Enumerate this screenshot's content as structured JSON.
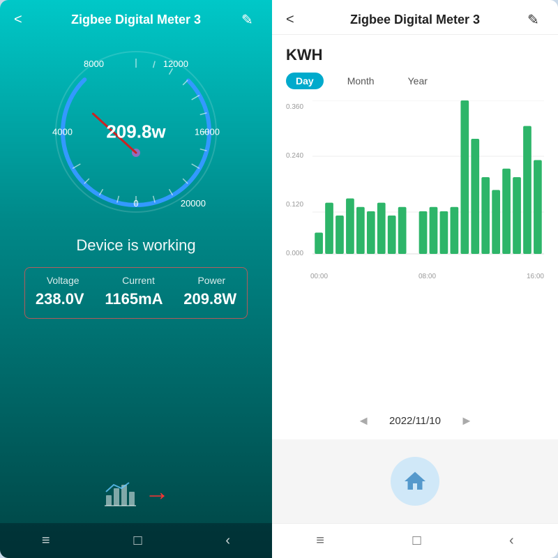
{
  "leftPanel": {
    "header": {
      "title": "Zigbee Digital Meter 3",
      "backLabel": "<",
      "editLabel": "✎"
    },
    "gauge": {
      "value": "209.8w",
      "scaleLabels": [
        "0",
        "4000",
        "8000",
        "12000",
        "16000",
        "20000"
      ]
    },
    "status": "Device is working",
    "stats": {
      "headers": [
        "Voltage",
        "Current",
        "Power"
      ],
      "values": [
        "238.0V",
        "1165mA",
        "209.8W"
      ]
    },
    "navBar": {
      "menu": "≡",
      "home": "□",
      "back": "‹"
    }
  },
  "rightPanel": {
    "header": {
      "title": "Zigbee Digital Meter 3",
      "backLabel": "<",
      "editLabel": "✎"
    },
    "kwhLabel": "KWH",
    "tabs": [
      "Day",
      "Month",
      "Year"
    ],
    "activeTab": "Day",
    "chart": {
      "yLabels": [
        "0.360",
        "0.240",
        "0.120",
        "0.000"
      ],
      "xLabels": [
        "00:00",
        "08:00",
        "16:00"
      ],
      "bars": [
        0.05,
        0.12,
        0.09,
        0.13,
        0.11,
        0.1,
        0.12,
        0.09,
        0.11,
        0.0,
        0.1,
        0.11,
        0.1,
        0.11,
        0.36,
        0.27,
        0.18,
        0.15,
        0.2,
        0.18,
        0.3,
        0.22
      ]
    },
    "dateNav": {
      "prev": "◄",
      "label": "2022/11/10",
      "next": "►"
    },
    "navBar": {
      "menu": "≡",
      "home": "□",
      "back": "‹"
    }
  }
}
